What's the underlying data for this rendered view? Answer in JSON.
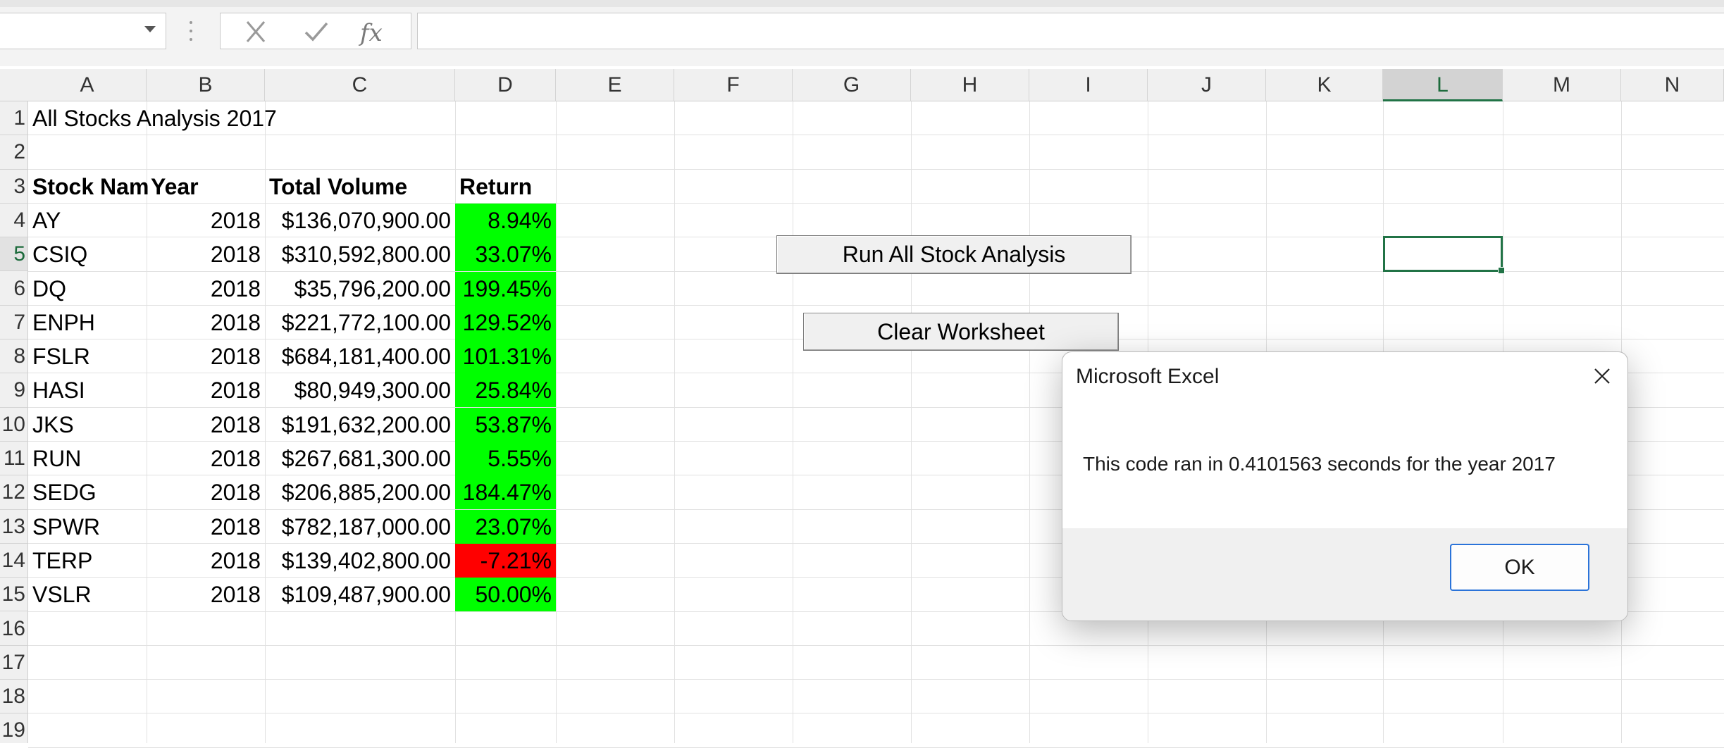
{
  "formula_bar": {
    "name_box_value": "",
    "formula_value": "",
    "cancel_icon": "close-icon",
    "confirm_icon": "checkmark-icon",
    "function_label": "fx"
  },
  "columns": [
    "A",
    "B",
    "C",
    "D",
    "E",
    "F",
    "G",
    "H",
    "I",
    "J",
    "K",
    "L",
    "M",
    "N"
  ],
  "selected_column": "L",
  "rows": [
    "1",
    "2",
    "3",
    "4",
    "5",
    "6",
    "7",
    "8",
    "9",
    "10",
    "11",
    "12",
    "13",
    "14",
    "15",
    "16",
    "17",
    "18",
    "19"
  ],
  "selected_row": "5",
  "sheet": {
    "title": "All Stocks Analysis  2017",
    "headers": {
      "ticker": "Stock Nam",
      "year": "Year",
      "volume": "Total Volume",
      "return": "Return"
    },
    "stocks": [
      {
        "ticker": "AY",
        "year": "2018",
        "volume": "$136,070,900.00",
        "return": "8.94%"
      },
      {
        "ticker": "CSIQ",
        "year": "2018",
        "volume": "$310,592,800.00",
        "return": "33.07%"
      },
      {
        "ticker": "DQ",
        "year": "2018",
        "volume": "$35,796,200.00",
        "return": "199.45%"
      },
      {
        "ticker": "ENPH",
        "year": "2018",
        "volume": "$221,772,100.00",
        "return": "129.52%"
      },
      {
        "ticker": "FSLR",
        "year": "2018",
        "volume": "$684,181,400.00",
        "return": "101.31%"
      },
      {
        "ticker": "HASI",
        "year": "2018",
        "volume": "$80,949,300.00",
        "return": "25.84%"
      },
      {
        "ticker": "JKS",
        "year": "2018",
        "volume": "$191,632,200.00",
        "return": "53.87%"
      },
      {
        "ticker": "RUN",
        "year": "2018",
        "volume": "$267,681,300.00",
        "return": "5.55%"
      },
      {
        "ticker": "SEDG",
        "year": "2018",
        "volume": "$206,885,200.00",
        "return": "184.47%"
      },
      {
        "ticker": "SPWR",
        "year": "2018",
        "volume": "$782,187,000.00",
        "return": "23.07%"
      },
      {
        "ticker": "TERP",
        "year": "2018",
        "volume": "$139,402,800.00",
        "return": "-7.21%"
      },
      {
        "ticker": "VSLR",
        "year": "2018",
        "volume": "$109,487,900.00",
        "return": "50.00%"
      }
    ]
  },
  "colors": {
    "positive": "#00ff00",
    "negative": "#ff0000",
    "accent": "#217346"
  },
  "buttons": {
    "run": "Run All Stock Analysis",
    "clear": "Clear Worksheet"
  },
  "dialog": {
    "title": "Microsoft Excel",
    "message": "This code ran in 0.4101563 seconds for the year  2017",
    "ok": "OK"
  }
}
